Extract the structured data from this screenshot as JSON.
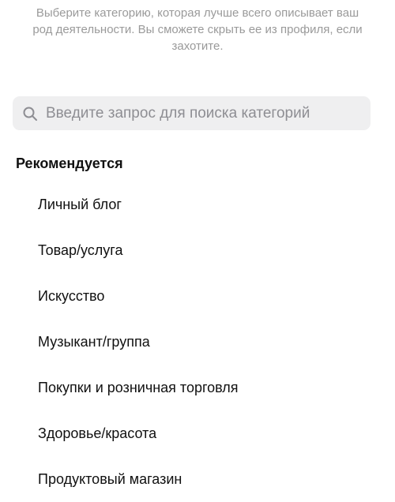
{
  "description": {
    "text": "Выберите категорию, которая лучше всего описывает ваш род деятельности. Вы сможете скрыть ее из профиля, если захотите."
  },
  "search": {
    "placeholder": "Введите запрос для поиска категорий",
    "icon": "search-icon"
  },
  "section": {
    "title": "Рекомендуется"
  },
  "categories": [
    {
      "label": "Личный блог"
    },
    {
      "label": "Товар/услуга"
    },
    {
      "label": "Искусство"
    },
    {
      "label": "Музыкант/группа"
    },
    {
      "label": "Покупки и розничная торговля"
    },
    {
      "label": "Здоровье/красота"
    },
    {
      "label": "Продуктовый магазин"
    }
  ],
  "colors": {
    "search_background": "#efeff0",
    "muted_text": "#9a9a9a",
    "placeholder_text": "#8e8e93",
    "primary_text": "#111111"
  }
}
